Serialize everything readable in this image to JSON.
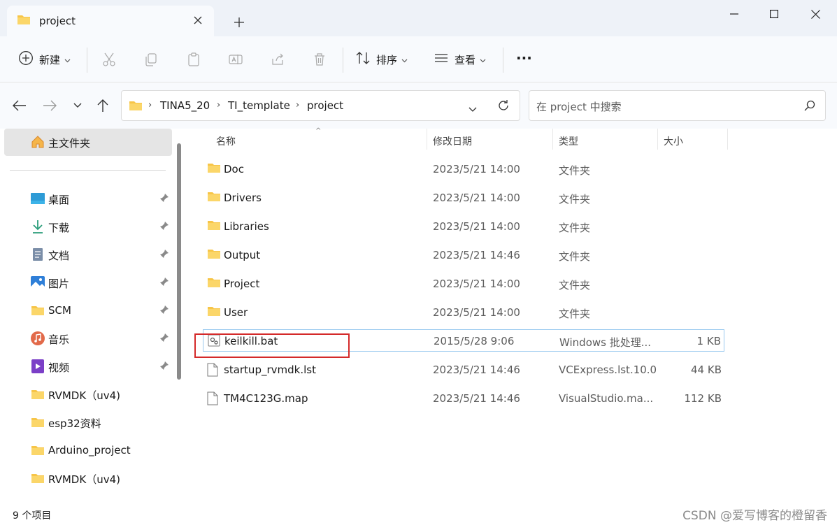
{
  "window": {
    "tab_title": "project",
    "new_tab": "+",
    "minimize": "—",
    "maximize": "☐",
    "close": "✕"
  },
  "toolbar": {
    "new_label": "新建",
    "sort_label": "排序",
    "view_label": "查看",
    "more_label": "···"
  },
  "nav": {
    "breadcrumb": [
      "TINA5_20",
      "TI_template",
      "project"
    ],
    "search_placeholder": "在 project 中搜索"
  },
  "sidebar": {
    "home": "主文件夹",
    "items": [
      {
        "label": "桌面",
        "icon": "desktop-icon",
        "pinned": true
      },
      {
        "label": "下载",
        "icon": "download-icon",
        "pinned": true
      },
      {
        "label": "文档",
        "icon": "document-icon",
        "pinned": true
      },
      {
        "label": "图片",
        "icon": "picture-icon",
        "pinned": true
      },
      {
        "label": "SCM",
        "icon": "folder-icon",
        "pinned": true
      },
      {
        "label": "音乐",
        "icon": "music-icon",
        "pinned": true
      },
      {
        "label": "视频",
        "icon": "video-icon",
        "pinned": true
      },
      {
        "label": "RVMDK（uv4)",
        "icon": "folder-icon",
        "pinned": false
      },
      {
        "label": "esp32资料",
        "icon": "folder-icon",
        "pinned": false
      },
      {
        "label": "Arduino_project",
        "icon": "folder-icon",
        "pinned": false
      },
      {
        "label": "RVMDK（uv4)",
        "icon": "folder-icon",
        "pinned": false
      }
    ]
  },
  "columns": {
    "name": "名称",
    "date": "修改日期",
    "type": "类型",
    "size": "大小"
  },
  "files": [
    {
      "name": "Doc",
      "date": "2023/5/21 14:00",
      "type": "文件夹",
      "size": "",
      "kind": "folder"
    },
    {
      "name": "Drivers",
      "date": "2023/5/21 14:00",
      "type": "文件夹",
      "size": "",
      "kind": "folder"
    },
    {
      "name": "Libraries",
      "date": "2023/5/21 14:00",
      "type": "文件夹",
      "size": "",
      "kind": "folder"
    },
    {
      "name": "Output",
      "date": "2023/5/21 14:46",
      "type": "文件夹",
      "size": "",
      "kind": "folder"
    },
    {
      "name": "Project",
      "date": "2023/5/21 14:00",
      "type": "文件夹",
      "size": "",
      "kind": "folder"
    },
    {
      "name": "User",
      "date": "2023/5/21 14:00",
      "type": "文件夹",
      "size": "",
      "kind": "folder"
    },
    {
      "name": "keilkill.bat",
      "date": "2015/5/28 9:06",
      "type": "Windows 批处理...",
      "size": "1 KB",
      "kind": "bat"
    },
    {
      "name": "startup_rvmdk.lst",
      "date": "2023/5/21 14:46",
      "type": "VCExpress.lst.10.0",
      "size": "44 KB",
      "kind": "file"
    },
    {
      "name": "TM4C123G.map",
      "date": "2023/5/21 14:46",
      "type": "VisualStudio.ma...",
      "size": "112 KB",
      "kind": "file"
    }
  ],
  "status": {
    "count": "9 个项目",
    "watermark": "CSDN @爱写博客的橙留香"
  },
  "colors": {
    "folder": "#f7c548",
    "highlight_box": "#d42a2a",
    "selection_border": "#99c9ef"
  }
}
